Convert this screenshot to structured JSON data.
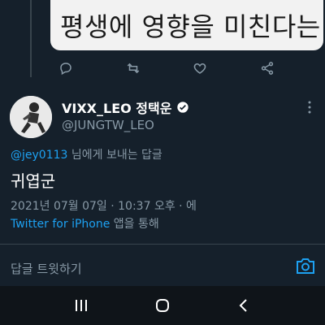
{
  "quoted_tweet": {
    "text": "평생에 영향을 미친다는 얘"
  },
  "tweet": {
    "display_name": "VIXX_LEO 정택운",
    "handle": "@JUNGTW_LEO",
    "reply_to_mention": "@jey0113",
    "reply_to_suffix": " 님에게 보내는 답글",
    "text": "귀엽군",
    "meta": "2021년 07월 07일 · 10:37 오후 · 에",
    "source_client": "Twitter for iPhone",
    "source_suffix": " 앱을 통해"
  },
  "reply_box": {
    "placeholder": "답글 트윗하기"
  },
  "icons": {
    "reply": "reply-icon",
    "retweet": "retweet-icon",
    "like": "like-icon",
    "share": "share-icon",
    "verified": "verified-icon",
    "more": "more-icon",
    "camera": "camera-icon",
    "recents": "recents-icon",
    "home": "home-icon",
    "back": "back-icon"
  },
  "colors": {
    "background": "#15202b",
    "accent": "#1da1f2",
    "secondary_text": "#8899a6",
    "divider": "#38444d"
  }
}
